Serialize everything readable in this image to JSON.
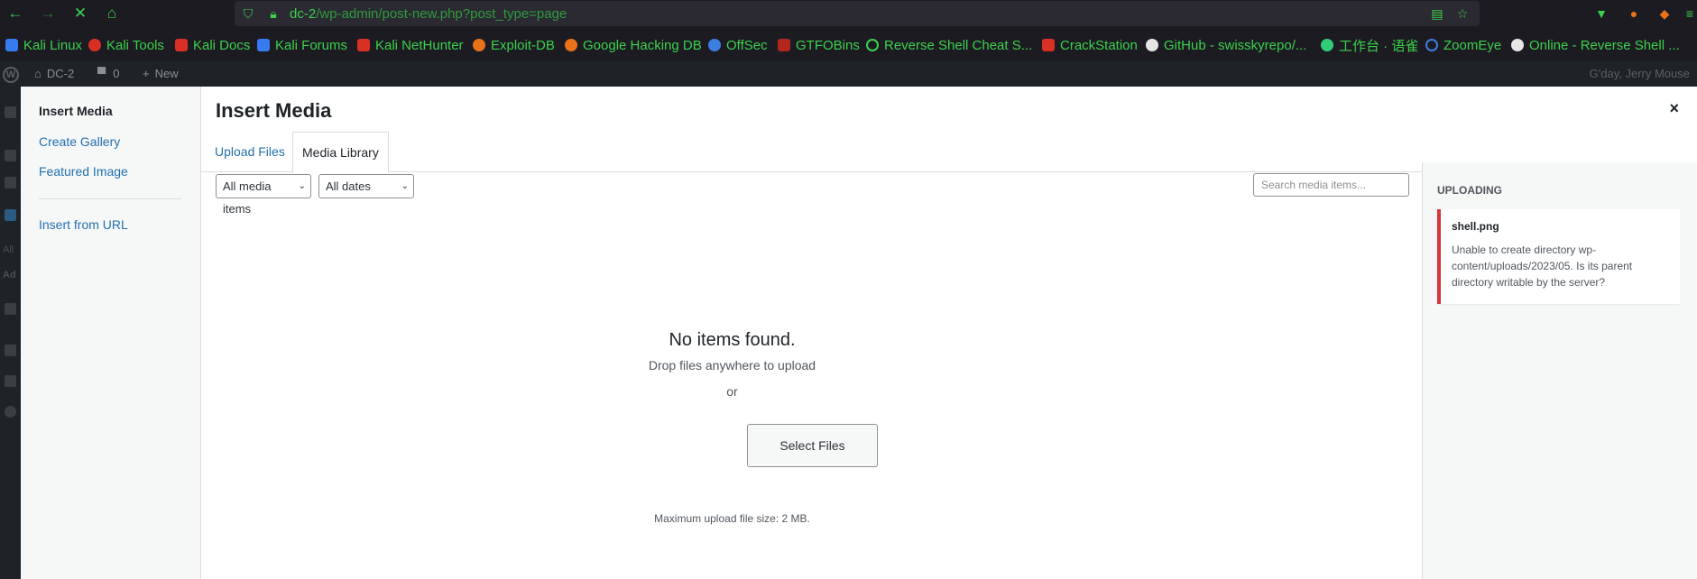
{
  "browser": {
    "url_host": "dc-2",
    "url_path": "/wp-admin/post-new.php?post_type=page",
    "bookmarks": [
      {
        "label": "Kali Linux",
        "color": "#367bf0"
      },
      {
        "label": "Kali Tools",
        "color": "#d93025"
      },
      {
        "label": "Kali Docs",
        "color": "#d93025"
      },
      {
        "label": "Kali Forums",
        "color": "#367bf0"
      },
      {
        "label": "Kali NetHunter",
        "color": "#d93025"
      },
      {
        "label": "Exploit-DB",
        "color": "#e8731a"
      },
      {
        "label": "Google Hacking DB",
        "color": "#e8731a"
      },
      {
        "label": "OffSec",
        "color": "#3d7fe0"
      },
      {
        "label": "GTFOBins",
        "color": "#b3261e"
      },
      {
        "label": "Reverse Shell Cheat S...",
        "color": "#3bd14b"
      },
      {
        "label": "CrackStation",
        "color": "#d93025"
      },
      {
        "label": "GitHub - swisskyrepo/...",
        "color": "#e6e6e6"
      },
      {
        "label": "工作台 · 语雀",
        "color": "#31cc77"
      },
      {
        "label": "ZoomEye",
        "color": "#3d7fe0"
      },
      {
        "label": "Online - Reverse Shell ...",
        "color": "#e6e6e6"
      }
    ]
  },
  "admin_bar": {
    "site_name": "DC-2",
    "comments_count": "0",
    "new_label": "New",
    "greeting": "G'day, Jerry Mouse"
  },
  "admin_side": {
    "text_1": "All",
    "text_2": "Ad"
  },
  "modal": {
    "menu": {
      "insert_media": "Insert Media",
      "create_gallery": "Create Gallery",
      "featured_image": "Featured Image",
      "insert_from_url": "Insert from URL"
    },
    "title": "Insert Media",
    "close": "×",
    "tabs": {
      "upload_files": "Upload Files",
      "media_library": "Media Library"
    },
    "filters": {
      "media_type": "All media items",
      "dates": "All dates",
      "search_placeholder": "Search media items..."
    },
    "empty": {
      "no_items": "No items found.",
      "drop_text": "Drop files anywhere to upload",
      "or_text": "or",
      "select_files": "Select Files",
      "max_size": "Maximum upload file size: 2 MB."
    },
    "uploading": {
      "heading": "Uploading",
      "file_name": "shell.png",
      "error_message": "Unable to create directory wp-content/uploads/2023/05. Is its parent directory writable by the server?"
    }
  }
}
